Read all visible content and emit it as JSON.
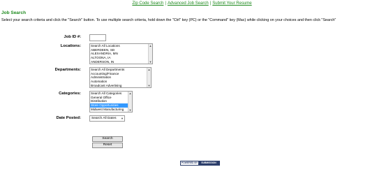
{
  "top_links": [
    "Zip Code Search",
    "Advanced Job Search",
    "Submit Your Resume"
  ],
  "separator": "|",
  "page_title": "Job Search",
  "instructions": "Select your search criteria and click the \"Search\" button. To use multiple search criteria, hold down the \"Ctrl\" key (PC) or the \"Command\" key (Mac) while clicking on your choices and then click \"Search\"",
  "fields": {
    "job_id": {
      "label": "Job ID #:",
      "value": ""
    },
    "locations": {
      "label": "Locations:",
      "options": [
        "Search All Locations",
        "ABERDEEN, SD",
        "ALEXANDRIA, MN",
        "ALTOONA, IA",
        "ANDERSON, IN"
      ]
    },
    "departments": {
      "label": "Departments:",
      "options": [
        "Search All Departments",
        "Accounting/Finance",
        "Administration",
        "Automation",
        "Broadcast Advertising"
      ]
    },
    "categories": {
      "label": "Categories:",
      "options": [
        "Search All Categories",
        "General Office",
        "Distribution",
        "Store Opportunities",
        "Midwest Manufacturing"
      ],
      "selected_index": 3
    },
    "date_posted": {
      "label": "Date Posted:",
      "value": "Search All Dates"
    }
  },
  "buttons": {
    "search": "Search",
    "reset": "Reset"
  },
  "badge": {
    "left": "POWERED BY",
    "right": "SUBMISSION"
  }
}
